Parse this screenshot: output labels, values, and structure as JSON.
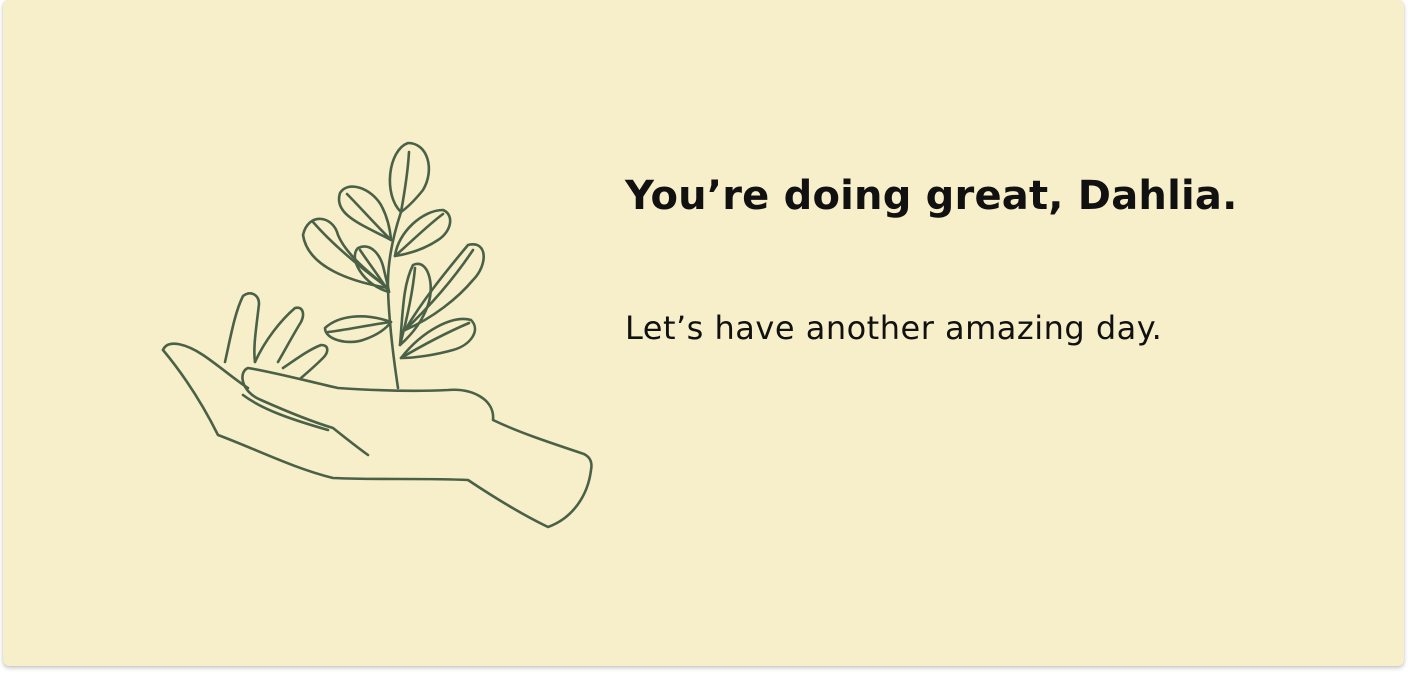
{
  "card": {
    "background": "#f6efc9",
    "illustration_icon": "hand-holding-plant-icon",
    "illustration_color": "#4a6148",
    "headline": "You’re doing great, Dahlia.",
    "subline": "Let’s have another amazing day."
  }
}
